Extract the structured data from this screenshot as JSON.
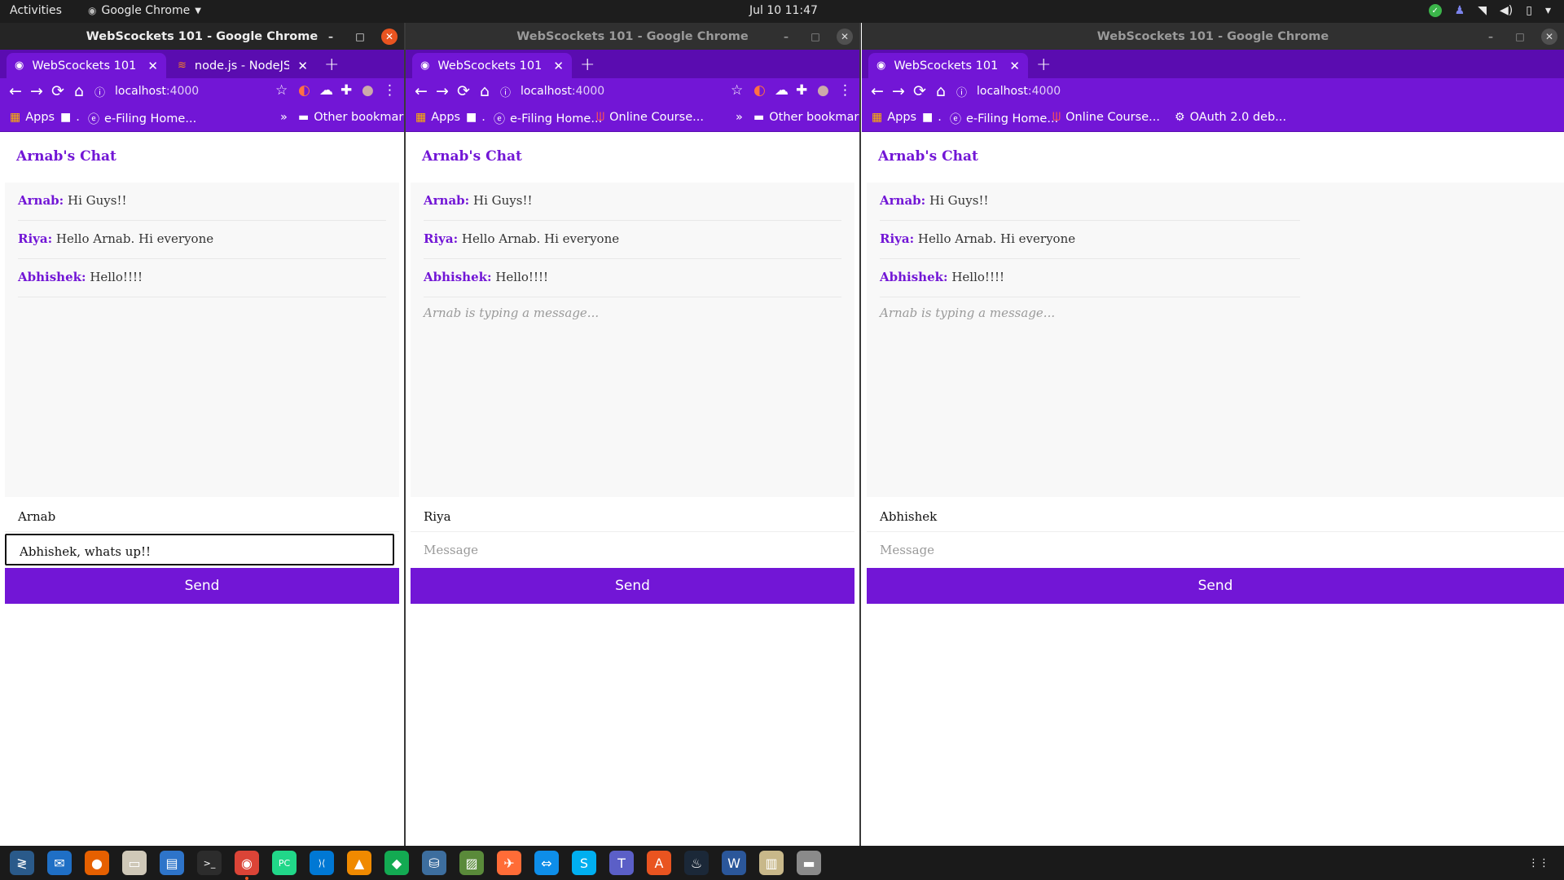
{
  "topbar": {
    "activities": "Activities",
    "app_name": "Google Chrome",
    "clock": "Jul 10  11:47"
  },
  "windows": [
    {
      "title": "WebScockets 101 - Google Chrome",
      "active": true,
      "tabs": [
        {
          "label": "WebScockets 101",
          "selected": true
        },
        {
          "label": "node.js - NodeJS - Error: U",
          "selected": false
        }
      ],
      "url_host": "localhost",
      "url_port": ":4000",
      "bookmarks": [
        {
          "label": "Apps"
        },
        {
          "label": "."
        },
        {
          "label": "e-Filing Home..."
        }
      ],
      "bookmarks_more": "»",
      "other_bookmarks": "Other bookmarks",
      "chat": {
        "title": "Arnab's Chat",
        "messages": [
          {
            "user": "Arnab:",
            "text": "Hi Guys!!"
          },
          {
            "user": "Riya:",
            "text": "Hello Arnab. Hi everyone"
          },
          {
            "user": "Abhishek:",
            "text": "Hello!!!!"
          }
        ],
        "typing": "",
        "name_value": "Arnab",
        "message_value": "Abhishek, whats up!!",
        "message_placeholder": "Message",
        "send_label": "Send"
      }
    },
    {
      "title": "WebScockets 101 - Google Chrome",
      "active": false,
      "tabs": [
        {
          "label": "WebScockets 101",
          "selected": true
        }
      ],
      "url_host": "localhost",
      "url_port": ":4000",
      "bookmarks": [
        {
          "label": "Apps"
        },
        {
          "label": "."
        },
        {
          "label": "e-Filing Home..."
        },
        {
          "label": "Online Course..."
        }
      ],
      "bookmarks_more": "»",
      "other_bookmarks": "Other bookmarks",
      "chat": {
        "title": "Arnab's Chat",
        "messages": [
          {
            "user": "Arnab:",
            "text": "Hi Guys!!"
          },
          {
            "user": "Riya:",
            "text": "Hello Arnab. Hi everyone"
          },
          {
            "user": "Abhishek:",
            "text": "Hello!!!!"
          }
        ],
        "typing": "Arnab is typing a message...",
        "name_value": "Riya",
        "message_value": "",
        "message_placeholder": "Message",
        "send_label": "Send"
      }
    },
    {
      "title": "WebScockets 101 - Google Chrome",
      "active": false,
      "tabs": [
        {
          "label": "WebScockets 101",
          "selected": true
        }
      ],
      "url_host": "localhost",
      "url_port": ":4000",
      "bookmarks": [
        {
          "label": "Apps"
        },
        {
          "label": "."
        },
        {
          "label": "e-Filing Home..."
        },
        {
          "label": "Online Course..."
        },
        {
          "label": "OAuth 2.0 deb..."
        }
      ],
      "bookmarks_more": "",
      "other_bookmarks": "",
      "chat": {
        "title": "Arnab's Chat",
        "messages": [
          {
            "user": "Arnab:",
            "text": "Hi Guys!!"
          },
          {
            "user": "Riya:",
            "text": "Hello Arnab. Hi everyone"
          },
          {
            "user": "Abhishek:",
            "text": "Hello!!!!"
          }
        ],
        "typing": "Arnab is typing a message...",
        "name_value": "Abhishek",
        "message_value": "",
        "message_placeholder": "Message",
        "send_label": "Send"
      }
    }
  ],
  "dock": [
    {
      "icon": "code-editor-icon",
      "glyph": "≷",
      "color": "#2a5a8a"
    },
    {
      "icon": "thunderbird-icon",
      "glyph": "✉",
      "color": "#1f6fc5"
    },
    {
      "icon": "firefox-icon",
      "glyph": "●",
      "color": "#e66000"
    },
    {
      "icon": "files-icon",
      "glyph": "▭",
      "color": "#cfc8b8"
    },
    {
      "icon": "libreoffice-writer-icon",
      "glyph": "▤",
      "color": "#2e74c9"
    },
    {
      "icon": "terminal-icon",
      "glyph": ">_",
      "color": "#2c2c2c"
    },
    {
      "icon": "chrome-icon",
      "glyph": "◉",
      "color": "#db4437"
    },
    {
      "icon": "pycharm-icon",
      "glyph": "PC",
      "color": "#21d789"
    },
    {
      "icon": "vscode-icon",
      "glyph": "⟩⟨",
      "color": "#0078d4"
    },
    {
      "icon": "vlc-icon",
      "glyph": "▲",
      "color": "#f08a00"
    },
    {
      "icon": "mongodb-compass-icon",
      "glyph": "◆",
      "color": "#13aa52"
    },
    {
      "icon": "mysql-workbench-icon",
      "glyph": "⛁",
      "color": "#3d6e9e"
    },
    {
      "icon": "image-viewer-icon",
      "glyph": "▨",
      "color": "#5a8a3a"
    },
    {
      "icon": "postman-icon",
      "glyph": "✈",
      "color": "#ff6c37"
    },
    {
      "icon": "teamviewer-icon",
      "glyph": "⇔",
      "color": "#0e8ee9"
    },
    {
      "icon": "skype-icon",
      "glyph": "S",
      "color": "#00aff0"
    },
    {
      "icon": "teams-icon",
      "glyph": "T",
      "color": "#5b5fc7"
    },
    {
      "icon": "software-center-icon",
      "glyph": "A",
      "color": "#e95420"
    },
    {
      "icon": "steam-icon",
      "glyph": "♨",
      "color": "#1b2838"
    },
    {
      "icon": "word-icon",
      "glyph": "W",
      "color": "#2b579a"
    },
    {
      "icon": "archive-icon",
      "glyph": "▥",
      "color": "#c8b88a"
    },
    {
      "icon": "drive-icon",
      "glyph": "▬",
      "color": "#8a8a8a"
    }
  ],
  "colors": {
    "accent": "#7216d6",
    "tabstrip": "#5a0cb0",
    "ubuntu_orange": "#e95420"
  }
}
